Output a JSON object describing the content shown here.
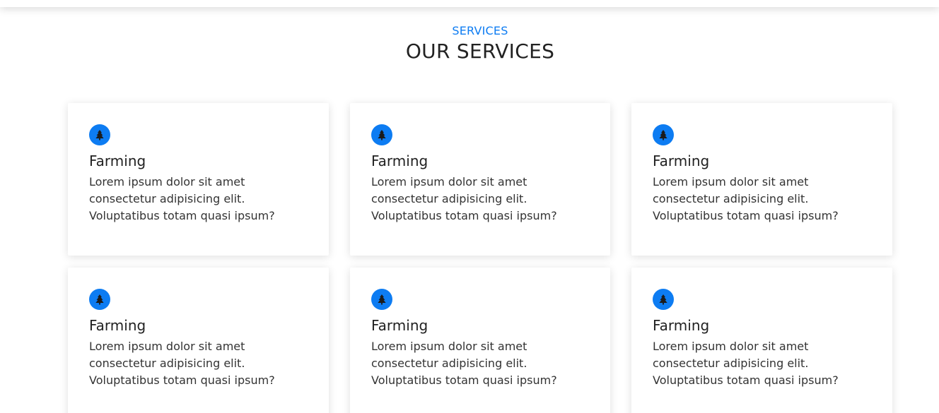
{
  "colors": {
    "accent": "#0d7cf2",
    "heading": "#222222",
    "text": "#333333"
  },
  "header": {
    "eyebrow": "SERVICES",
    "title": "OUR SERVICES"
  },
  "services": [
    {
      "icon": "tree-icon",
      "title": "Farming",
      "text": "Lorem ipsum dolor sit amet consectetur adipisicing elit. Voluptatibus totam quasi ipsum?"
    },
    {
      "icon": "tree-icon",
      "title": "Farming",
      "text": "Lorem ipsum dolor sit amet consectetur adipisicing elit. Voluptatibus totam quasi ipsum?"
    },
    {
      "icon": "tree-icon",
      "title": "Farming",
      "text": "Lorem ipsum dolor sit amet consectetur adipisicing elit. Voluptatibus totam quasi ipsum?"
    },
    {
      "icon": "tree-icon",
      "title": "Farming",
      "text": "Lorem ipsum dolor sit amet consectetur adipisicing elit. Voluptatibus totam quasi ipsum?"
    },
    {
      "icon": "tree-icon",
      "title": "Farming",
      "text": "Lorem ipsum dolor sit amet consectetur adipisicing elit. Voluptatibus totam quasi ipsum?"
    },
    {
      "icon": "tree-icon",
      "title": "Farming",
      "text": "Lorem ipsum dolor sit amet consectetur adipisicing elit. Voluptatibus totam quasi ipsum?"
    }
  ]
}
